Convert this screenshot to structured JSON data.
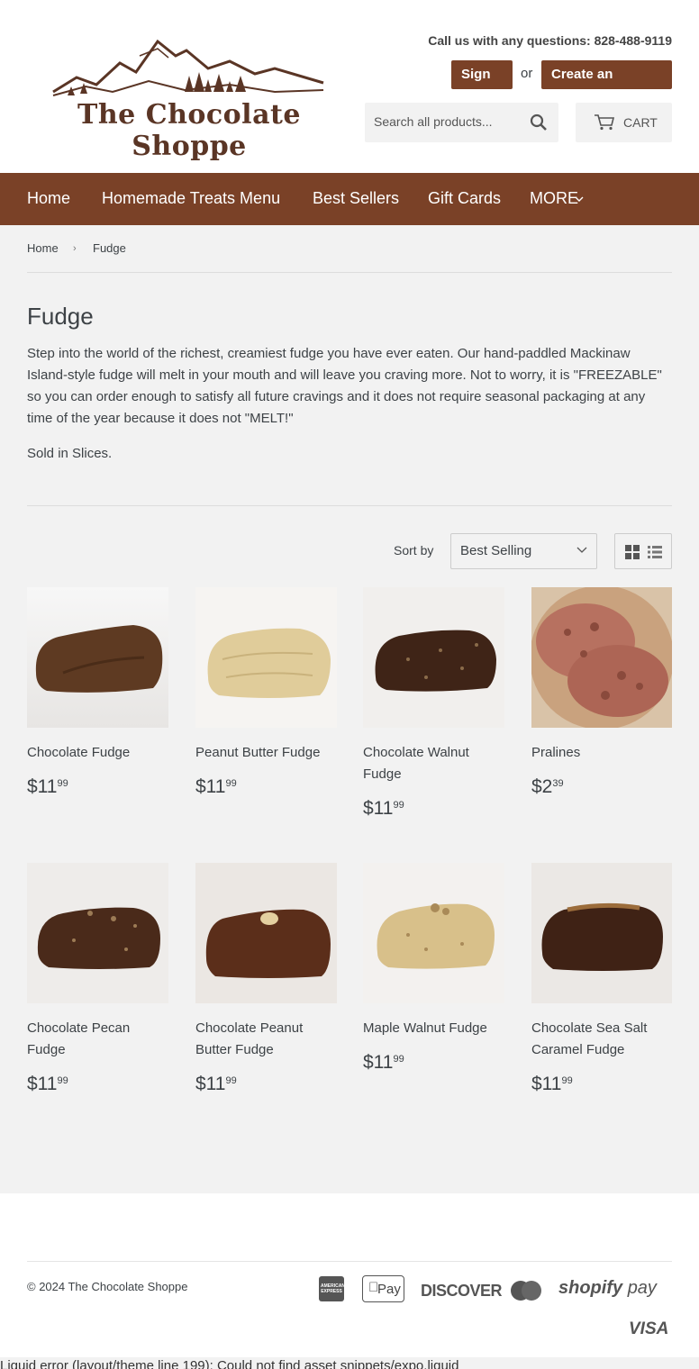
{
  "header": {
    "logo_text": "The Chocolate Shoppe",
    "phone_text": "Call us with any questions: 828-488-9119",
    "signin_label": "Sign in",
    "or_text": "or",
    "create_label": "Create an Account",
    "search_placeholder": "Search all products...",
    "cart_label": "CART",
    "brand_color": "#7a4127"
  },
  "nav": {
    "items": [
      {
        "label": "Home"
      },
      {
        "label": "Homemade Treats Menu"
      },
      {
        "label": "Best Sellers"
      },
      {
        "label": "Gift Cards"
      },
      {
        "label": "MORE"
      }
    ]
  },
  "breadcrumb": {
    "home": "Home",
    "separator": "›",
    "current": "Fudge"
  },
  "collection": {
    "title": "Fudge",
    "description": "Step into the world of the richest, creamiest fudge you have ever eaten.  Our hand-paddled Mackinaw Island-style fudge will melt in your mouth and will leave you craving more.  Not to worry, it is \"FREEZABLE\" so you can order enough to satisfy all future cravings and it does not require seasonal packaging at any time of the year because it does not \"MELT!\"",
    "sold_in": "Sold in Slices.",
    "sort_label": "Sort by",
    "sort_value": "Best Selling"
  },
  "products": [
    {
      "name": "Chocolate Fudge",
      "price_main": "$11",
      "price_cents": "99",
      "image": "dark-chocolate-fudge-slice"
    },
    {
      "name": "Peanut Butter Fudge",
      "price_main": "$11",
      "price_cents": "99",
      "image": "peanut-butter-fudge-slice"
    },
    {
      "name": "Chocolate Walnut Fudge",
      "price_main": "$11",
      "price_cents": "99",
      "image": "walnut-fudge-slice"
    },
    {
      "name": "Pralines",
      "price_main": "$2",
      "price_cents": "39",
      "image": "pralines-on-plate"
    },
    {
      "name": "Chocolate Pecan Fudge",
      "price_main": "$11",
      "price_cents": "99",
      "image": "pecan-fudge-slice"
    },
    {
      "name": "Chocolate Peanut Butter Fudge",
      "price_main": "$11",
      "price_cents": "99",
      "image": "chocolate-pb-fudge-slice"
    },
    {
      "name": "Maple Walnut Fudge",
      "price_main": "$11",
      "price_cents": "99",
      "image": "maple-walnut-fudge-slice"
    },
    {
      "name": "Chocolate Sea Salt Caramel Fudge",
      "price_main": "$11",
      "price_cents": "99",
      "image": "sea-salt-caramel-fudge-slice"
    }
  ],
  "footer": {
    "copyright": "© 2024 The Chocolate Shoppe",
    "payment_icons": [
      "american-express-icon",
      "apple-pay-icon",
      "discover-icon",
      "mastercard-icon",
      "shopify-pay-icon",
      "visa-icon"
    ],
    "applepay_text": "Pay",
    "discover_text": "DISCOVER",
    "shopify_text": "shopify",
    "shopify_pay_text": "pay",
    "visa_text": "VISA",
    "amex_text": "AMERICAN EXPRESS"
  },
  "error_text": "Liquid error (layout/theme line 199): Could not find asset snippets/expo.liquid"
}
